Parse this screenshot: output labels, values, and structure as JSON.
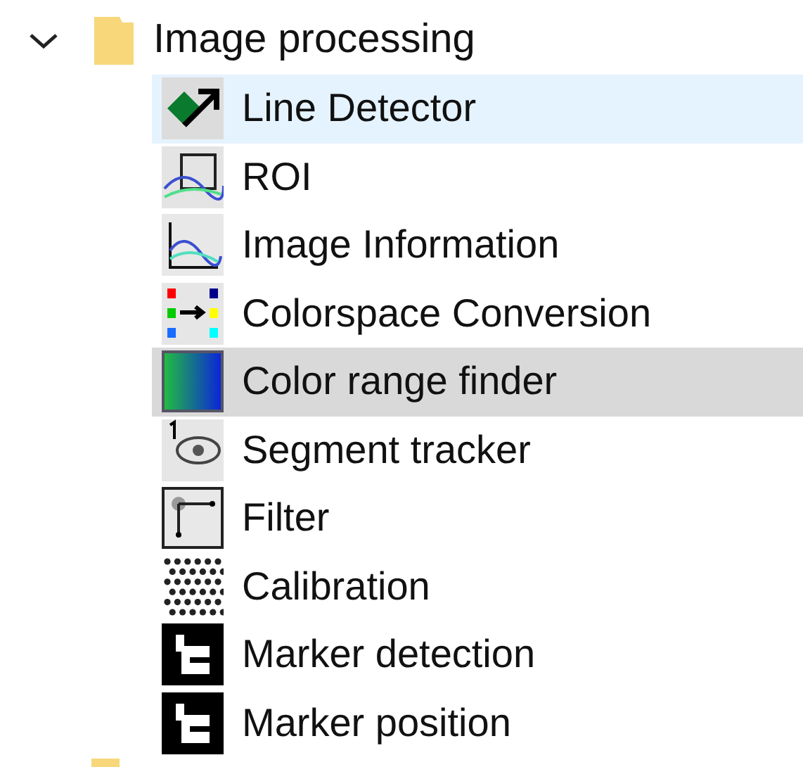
{
  "tree": {
    "label": "Image processing",
    "expanded": true,
    "children": [
      {
        "label": "Line Detector",
        "kind": "line",
        "selected": false,
        "hovered": true
      },
      {
        "label": "ROI",
        "kind": "roi",
        "selected": false,
        "hovered": false
      },
      {
        "label": "Image Information",
        "kind": "info",
        "selected": false,
        "hovered": false
      },
      {
        "label": "Colorspace Conversion",
        "kind": "colorspace",
        "selected": false,
        "hovered": false
      },
      {
        "label": "Color range finder",
        "kind": "range",
        "selected": true,
        "hovered": false
      },
      {
        "label": "Segment tracker",
        "kind": "segment",
        "selected": false,
        "hovered": false
      },
      {
        "label": "Filter",
        "kind": "filter",
        "selected": false,
        "hovered": false
      },
      {
        "label": "Calibration",
        "kind": "calibration",
        "selected": false,
        "hovered": false
      },
      {
        "label": "Marker detection",
        "kind": "marker",
        "selected": false,
        "hovered": false
      },
      {
        "label": "Marker position",
        "kind": "marker",
        "selected": false,
        "hovered": false
      }
    ]
  }
}
